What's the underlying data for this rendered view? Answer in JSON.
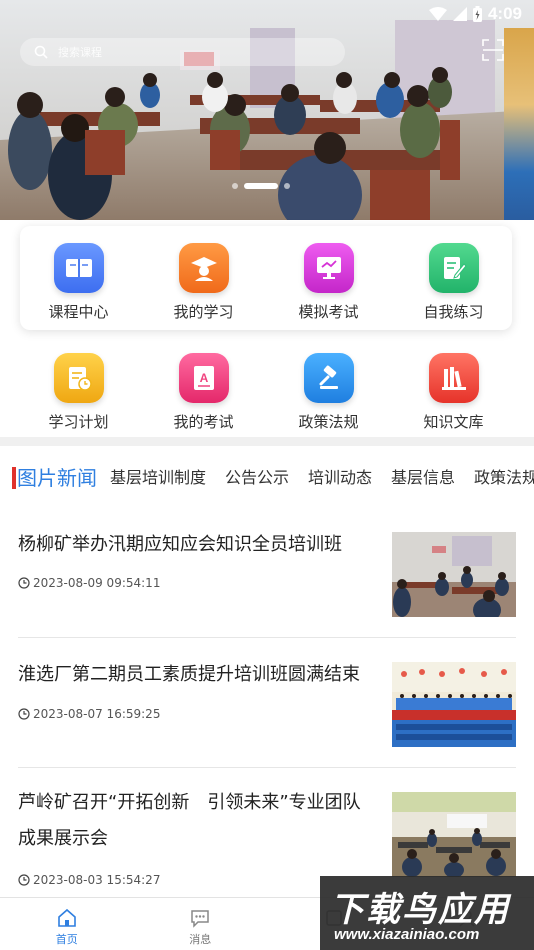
{
  "status_bar": {
    "time": "4:09"
  },
  "banner": {
    "search_placeholder": "搜索课程",
    "slide_count": 3,
    "active_slide": 2
  },
  "menu": {
    "row1": [
      {
        "label": "课程中心",
        "icon": "book-icon",
        "color": "#4c7cf0"
      },
      {
        "label": "我的学习",
        "icon": "graduate-icon",
        "color": "#f27a26"
      },
      {
        "label": "模拟考试",
        "icon": "monitor-icon",
        "color": "#d633d6"
      },
      {
        "label": "自我练习",
        "icon": "edit-icon",
        "color": "#2fbf7a"
      }
    ],
    "row2": [
      {
        "label": "学习计划",
        "icon": "plan-icon",
        "color": "#f2b61c"
      },
      {
        "label": "我的考试",
        "icon": "exam-icon",
        "color": "#f0437f"
      },
      {
        "label": "政策法规",
        "icon": "gavel-icon",
        "color": "#2c8fe6"
      },
      {
        "label": "知识文库",
        "icon": "library-icon",
        "color": "#f04b41"
      }
    ]
  },
  "tabs": [
    "图片新闻",
    "基层培训制度",
    "公告公示",
    "培训动态",
    "基层信息",
    "政策法规"
  ],
  "news": [
    {
      "title": "杨柳矿举办汛期应知应会知识全员培训班",
      "date": "2023-08-09 09:54:11"
    },
    {
      "title": "淮选厂第二期员工素质提升培训班圆满结束",
      "date": "2023-08-07 16:59:25"
    },
    {
      "title": "芦岭矿召开“开拓创新　引领未来”专业团队成果展示会",
      "date": "2023-08-03 15:54:27"
    }
  ],
  "bottom_nav": [
    {
      "label": "首页",
      "icon": "home-icon"
    },
    {
      "label": "消息",
      "icon": "message-icon"
    },
    {
      "label": "",
      "icon": "study-icon"
    },
    {
      "label": "",
      "icon": "profile-icon"
    }
  ],
  "watermark": {
    "big": "下载鸟应用",
    "small": "www.xiazainiao.com"
  },
  "colors": {
    "accent": "#2f7fe0",
    "tab_marker": "#e0322c"
  }
}
